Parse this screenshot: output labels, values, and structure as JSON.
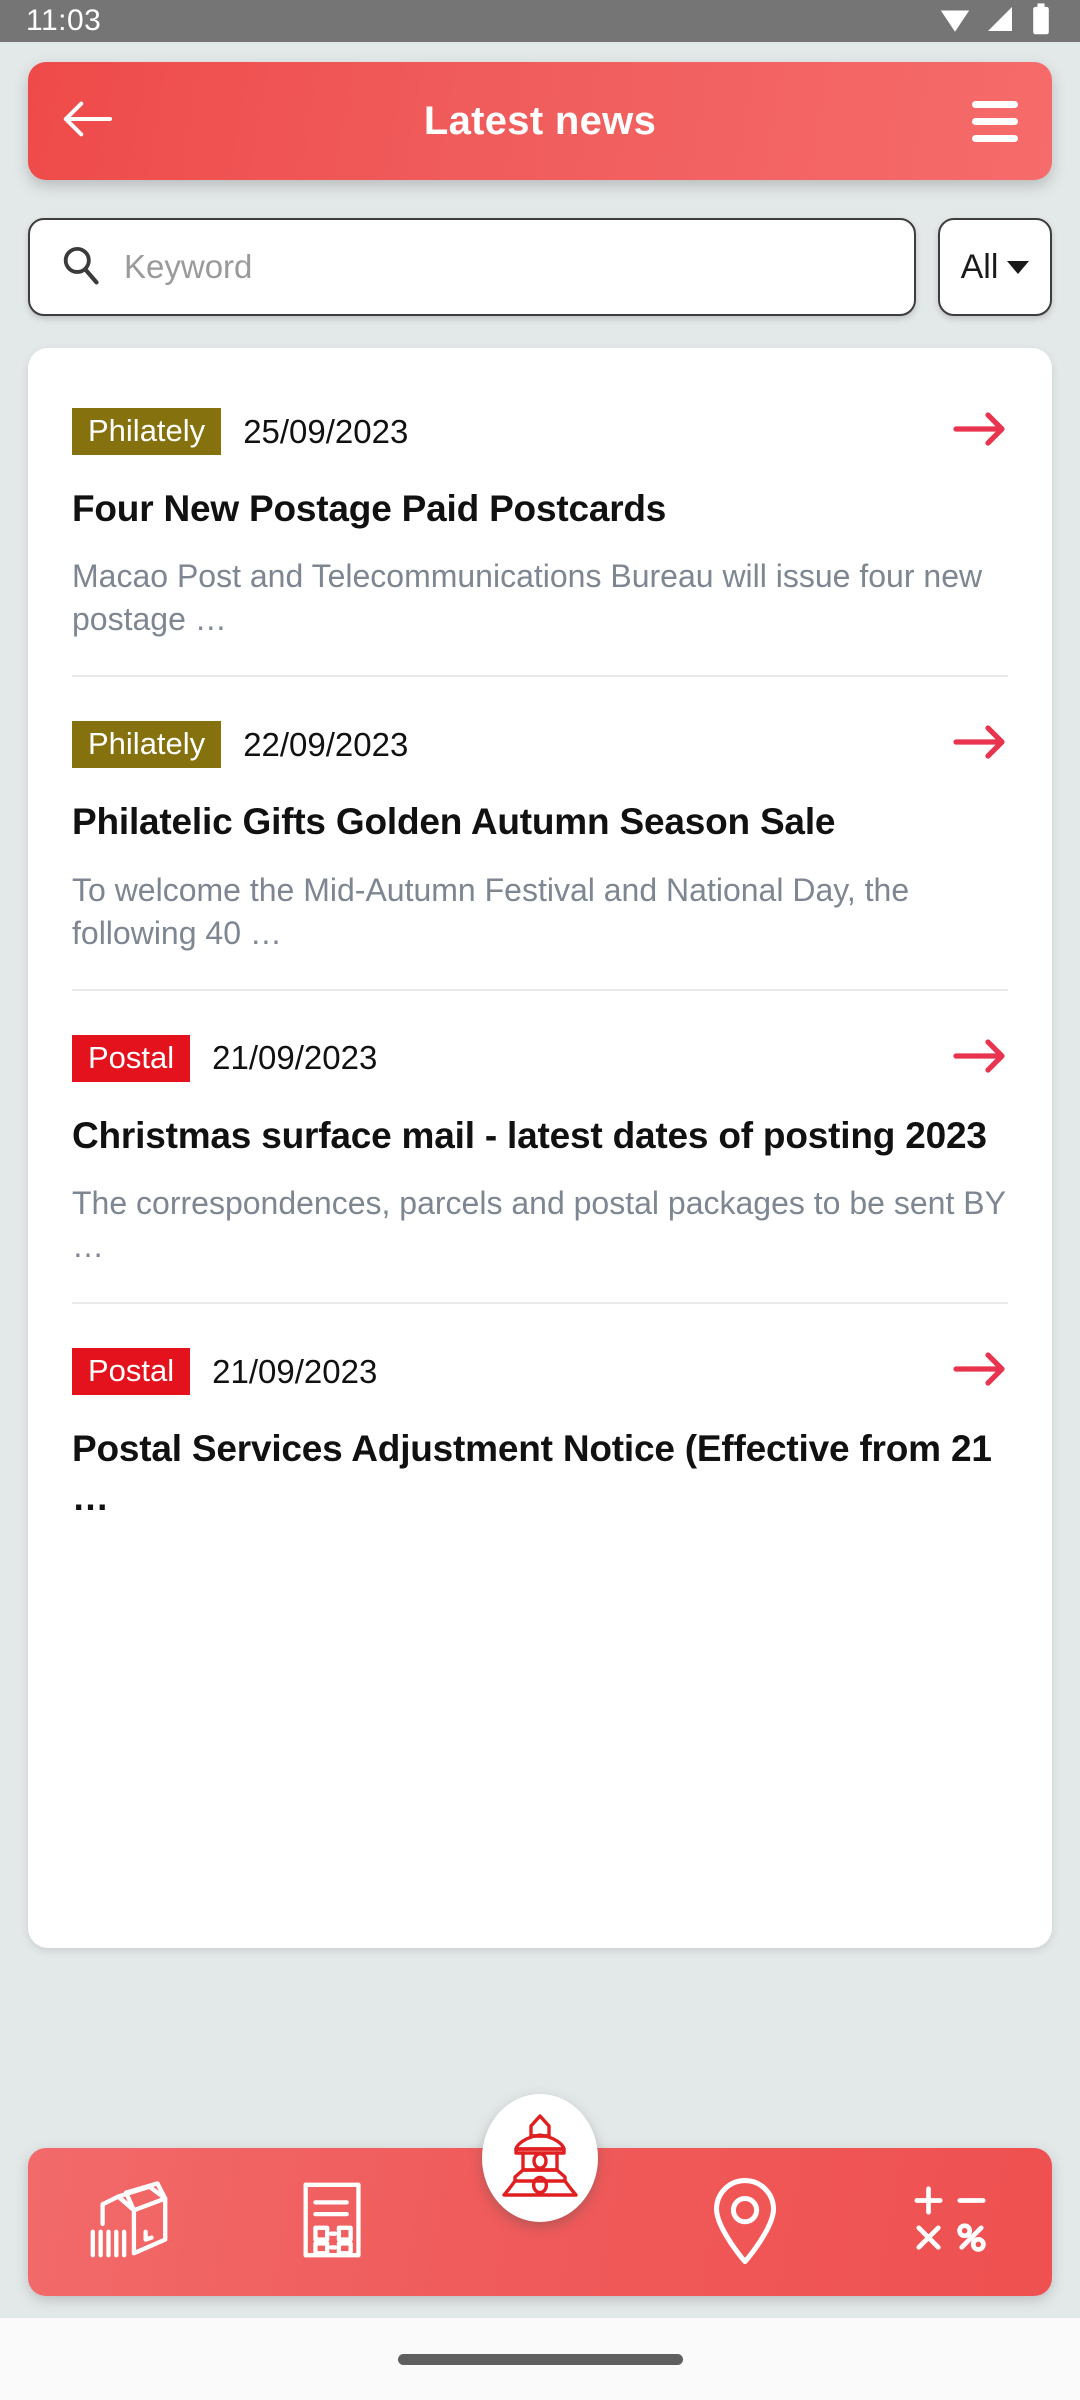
{
  "status_bar": {
    "time": "11:03",
    "icons": [
      "wifi-icon",
      "cellular-signal-icon",
      "battery-icon"
    ]
  },
  "app_bar": {
    "title": "Latest news",
    "back_icon": "arrow-left-icon",
    "menu_icon": "hamburger-menu-icon"
  },
  "search": {
    "icon": "search-icon",
    "placeholder": "Keyword",
    "value": "",
    "filter_label": "All",
    "filter_icon": "chevron-down-icon"
  },
  "colors": {
    "brand_red": "#f05b5b",
    "badge_postal": "#e4121c",
    "badge_philately": "#85710d",
    "arrow_red": "#e8344e",
    "page_background": "#e3e8e8",
    "status_bar": "#757575"
  },
  "news": {
    "arrow_icon": "arrow-right-icon",
    "items": [
      {
        "category": "Philately",
        "category_type": "philately",
        "date": "25/09/2023",
        "title": "Four New Postage Paid Postcards",
        "summary": "Macao Post and Telecommunications Bureau will issue four new postage …"
      },
      {
        "category": "Philately",
        "category_type": "philately",
        "date": "22/09/2023",
        "title": "Philatelic Gifts Golden Autumn Season Sale",
        "summary": "To welcome the Mid-Autumn Festival and National Day, the following 40 …"
      },
      {
        "category": "Postal",
        "category_type": "postal",
        "date": "21/09/2023",
        "title": "Christmas surface mail - latest dates of posting 2023",
        "summary": "The correspondences, parcels and postal packages to be sent BY …"
      },
      {
        "category": "Postal",
        "category_type": "postal",
        "date": "21/09/2023",
        "title": "Postal Services Adjustment Notice (Effective from 21 …",
        "summary": ""
      }
    ]
  },
  "bottom_nav": {
    "items": [
      {
        "icon": "parcel-box-icon"
      },
      {
        "icon": "document-qr-code-icon"
      },
      {
        "icon": "location-pin-icon"
      },
      {
        "icon": "calculator-icon"
      }
    ],
    "fab_icon": "guia-lighthouse-icon"
  },
  "system": {
    "gesture_bar": "home-gesture-bar"
  }
}
